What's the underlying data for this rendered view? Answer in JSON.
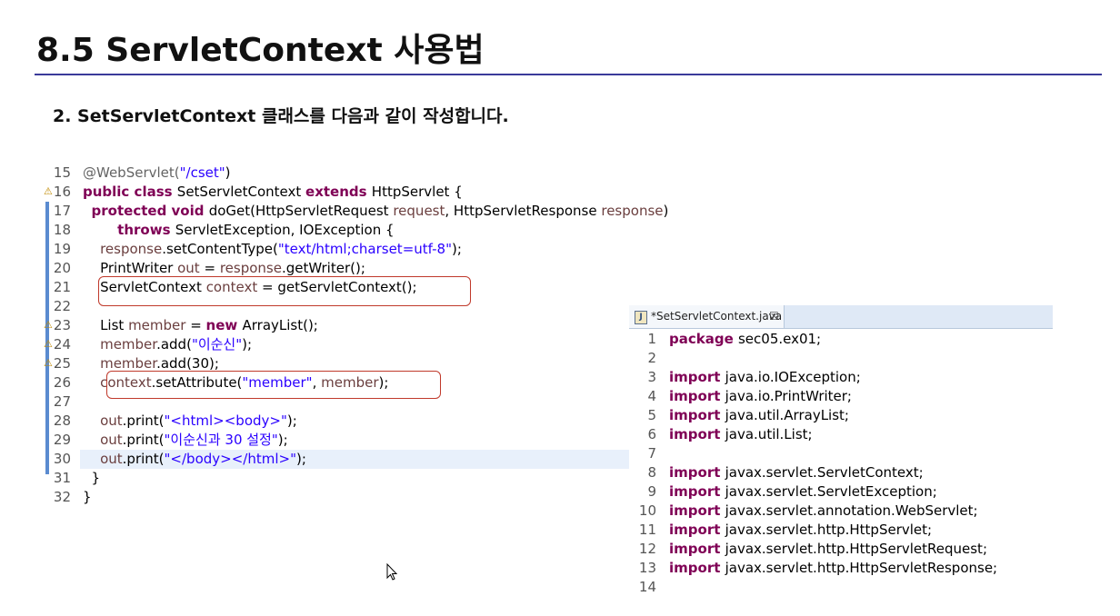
{
  "slide": {
    "title": "8.5 ServletContext 사용법",
    "subtitle": "2. SetServletContext 클래스를 다음과 같이 작성합니다."
  },
  "left_editor": {
    "lines": [
      {
        "n": "15",
        "tokens": [
          {
            "t": "ann",
            "v": "@WebServlet("
          },
          {
            "t": "str",
            "v": "\"/cset\""
          },
          {
            "t": "",
            "v": ")"
          }
        ]
      },
      {
        "n": "16",
        "tokens": [
          {
            "t": "kw",
            "v": "public class "
          },
          {
            "t": "",
            "v": "SetServletContext "
          },
          {
            "t": "kw",
            "v": "extends "
          },
          {
            "t": "",
            "v": "HttpServlet {"
          }
        ]
      },
      {
        "n": "17",
        "tokens": [
          {
            "t": "",
            "v": "  "
          },
          {
            "t": "kw",
            "v": "protected void "
          },
          {
            "t": "",
            "v": "doGet(HttpServletRequest "
          },
          {
            "t": "var",
            "v": "request"
          },
          {
            "t": "",
            "v": ", HttpServletResponse "
          },
          {
            "t": "var",
            "v": "response"
          },
          {
            "t": "",
            "v": ")"
          }
        ]
      },
      {
        "n": "18",
        "tokens": [
          {
            "t": "",
            "v": "        "
          },
          {
            "t": "kw",
            "v": "throws "
          },
          {
            "t": "",
            "v": "ServletException, IOException {"
          }
        ]
      },
      {
        "n": "19",
        "tokens": [
          {
            "t": "",
            "v": "    "
          },
          {
            "t": "var",
            "v": "response"
          },
          {
            "t": "",
            "v": ".setContentType("
          },
          {
            "t": "str",
            "v": "\"text/html;charset=utf-8\""
          },
          {
            "t": "",
            "v": ");"
          }
        ]
      },
      {
        "n": "20",
        "tokens": [
          {
            "t": "",
            "v": "    PrintWriter "
          },
          {
            "t": "var",
            "v": "out"
          },
          {
            "t": "",
            "v": " = "
          },
          {
            "t": "var",
            "v": "response"
          },
          {
            "t": "",
            "v": ".getWriter();"
          }
        ]
      },
      {
        "n": "21",
        "tokens": [
          {
            "t": "",
            "v": "    ServletContext "
          },
          {
            "t": "var",
            "v": "context"
          },
          {
            "t": "",
            "v": " = getServletContext();"
          }
        ]
      },
      {
        "n": "22",
        "tokens": []
      },
      {
        "n": "23",
        "tokens": [
          {
            "t": "",
            "v": "    List "
          },
          {
            "t": "var",
            "v": "member"
          },
          {
            "t": "",
            "v": " = "
          },
          {
            "t": "kw",
            "v": "new "
          },
          {
            "t": "",
            "v": "ArrayList();"
          }
        ]
      },
      {
        "n": "24",
        "tokens": [
          {
            "t": "",
            "v": "    "
          },
          {
            "t": "var",
            "v": "member"
          },
          {
            "t": "",
            "v": ".add("
          },
          {
            "t": "str",
            "v": "\"이순신\""
          },
          {
            "t": "",
            "v": ");"
          }
        ]
      },
      {
        "n": "25",
        "tokens": [
          {
            "t": "",
            "v": "    "
          },
          {
            "t": "var",
            "v": "member"
          },
          {
            "t": "",
            "v": ".add(30);"
          }
        ]
      },
      {
        "n": "26",
        "tokens": [
          {
            "t": "",
            "v": "    "
          },
          {
            "t": "var",
            "v": "context"
          },
          {
            "t": "",
            "v": ".setAttribute("
          },
          {
            "t": "str",
            "v": "\"member\""
          },
          {
            "t": "",
            "v": ", "
          },
          {
            "t": "var",
            "v": "member"
          },
          {
            "t": "",
            "v": ");"
          }
        ]
      },
      {
        "n": "27",
        "tokens": []
      },
      {
        "n": "28",
        "tokens": [
          {
            "t": "",
            "v": "    "
          },
          {
            "t": "var",
            "v": "out"
          },
          {
            "t": "",
            "v": ".print("
          },
          {
            "t": "str",
            "v": "\"<html><body>\""
          },
          {
            "t": "",
            "v": ");"
          }
        ]
      },
      {
        "n": "29",
        "tokens": [
          {
            "t": "",
            "v": "    "
          },
          {
            "t": "var",
            "v": "out"
          },
          {
            "t": "",
            "v": ".print("
          },
          {
            "t": "str",
            "v": "\"이순신과 30 설정\""
          },
          {
            "t": "",
            "v": ");"
          }
        ]
      },
      {
        "n": "30",
        "tokens": [
          {
            "t": "",
            "v": "    "
          },
          {
            "t": "var",
            "v": "out"
          },
          {
            "t": "",
            "v": ".print("
          },
          {
            "t": "str",
            "v": "\"</body></html>\""
          },
          {
            "t": "",
            "v": ");"
          }
        ]
      },
      {
        "n": "31",
        "tokens": [
          {
            "t": "",
            "v": "  }"
          }
        ]
      },
      {
        "n": "32",
        "tokens": [
          {
            "t": "",
            "v": "}"
          }
        ]
      }
    ]
  },
  "right_editor": {
    "tab_label": "*SetServletContext.java",
    "tab_close": "☒",
    "lines": [
      {
        "n": "1",
        "tokens": [
          {
            "t": "kw",
            "v": "package "
          },
          {
            "t": "",
            "v": "sec05.ex01;"
          }
        ]
      },
      {
        "n": "2",
        "tokens": []
      },
      {
        "n": "3",
        "tokens": [
          {
            "t": "kw",
            "v": "import "
          },
          {
            "t": "",
            "v": "java.io.IOException;"
          }
        ]
      },
      {
        "n": "4",
        "tokens": [
          {
            "t": "kw",
            "v": "import "
          },
          {
            "t": "",
            "v": "java.io.PrintWriter;"
          }
        ]
      },
      {
        "n": "5",
        "tokens": [
          {
            "t": "kw",
            "v": "import "
          },
          {
            "t": "",
            "v": "java.util.ArrayList;"
          }
        ]
      },
      {
        "n": "6",
        "tokens": [
          {
            "t": "kw",
            "v": "import "
          },
          {
            "t": "",
            "v": "java.util.List;"
          }
        ]
      },
      {
        "n": "7",
        "tokens": []
      },
      {
        "n": "8",
        "tokens": [
          {
            "t": "kw",
            "v": "import "
          },
          {
            "t": "",
            "v": "javax.servlet.ServletContext;"
          }
        ]
      },
      {
        "n": "9",
        "tokens": [
          {
            "t": "kw",
            "v": "import "
          },
          {
            "t": "",
            "v": "javax.servlet.ServletException;"
          }
        ]
      },
      {
        "n": "10",
        "tokens": [
          {
            "t": "kw",
            "v": "import "
          },
          {
            "t": "",
            "v": "javax.servlet.annotation.WebServlet;"
          }
        ]
      },
      {
        "n": "11",
        "tokens": [
          {
            "t": "kw",
            "v": "import "
          },
          {
            "t": "",
            "v": "javax.servlet.http.HttpServlet;"
          }
        ]
      },
      {
        "n": "12",
        "tokens": [
          {
            "t": "kw",
            "v": "import "
          },
          {
            "t": "",
            "v": "javax.servlet.http.HttpServletRequest;"
          }
        ]
      },
      {
        "n": "13",
        "tokens": [
          {
            "t": "kw",
            "v": "import "
          },
          {
            "t": "",
            "v": "javax.servlet.http.HttpServletResponse;"
          }
        ]
      },
      {
        "n": "14",
        "tokens": []
      }
    ]
  },
  "colors": {
    "keyword": "#7f0055",
    "string": "#2a00ff",
    "variable": "#6a3e3e",
    "annotation": "#646464",
    "highlight_box": "#c0392b",
    "title_rule": "#3a3a9a"
  }
}
